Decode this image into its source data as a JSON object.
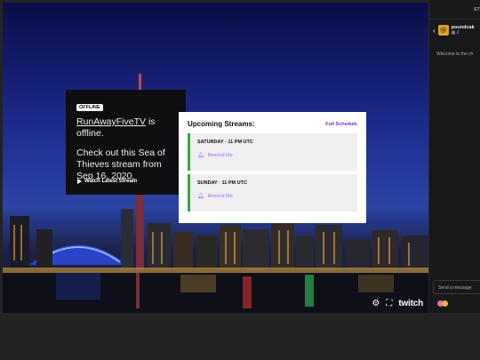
{
  "offline": {
    "badge": "OFFLINE",
    "channel": "RunAwayFiveTV",
    "title_suffix": "is offline.",
    "message": "Check out this Sea of Thieves stream from Sep 16, 2020.",
    "watch_label": "Watch Latest Stream"
  },
  "schedule": {
    "title": "Upcoming Streams:",
    "full_link": "Full Schedule",
    "items": [
      {
        "time": "SATURDAY · 11 PM UTC",
        "remind": "Remind Me"
      },
      {
        "time": "SUNDAY · 11 PM UTC",
        "remind": "Remind Me"
      }
    ]
  },
  "player": {
    "logo": "twitch",
    "icons": [
      "settings-icon",
      "fullscreen-icon"
    ]
  },
  "chat": {
    "header_label": "ST",
    "user_name": "poundcak",
    "user_count": "2",
    "welcome": "Welcome to the ch",
    "send_placeholder": "Send a message"
  },
  "colors": {
    "accent": "#772ce8",
    "schedule_bar": "#38a845",
    "chat_bg": "#18181b"
  }
}
